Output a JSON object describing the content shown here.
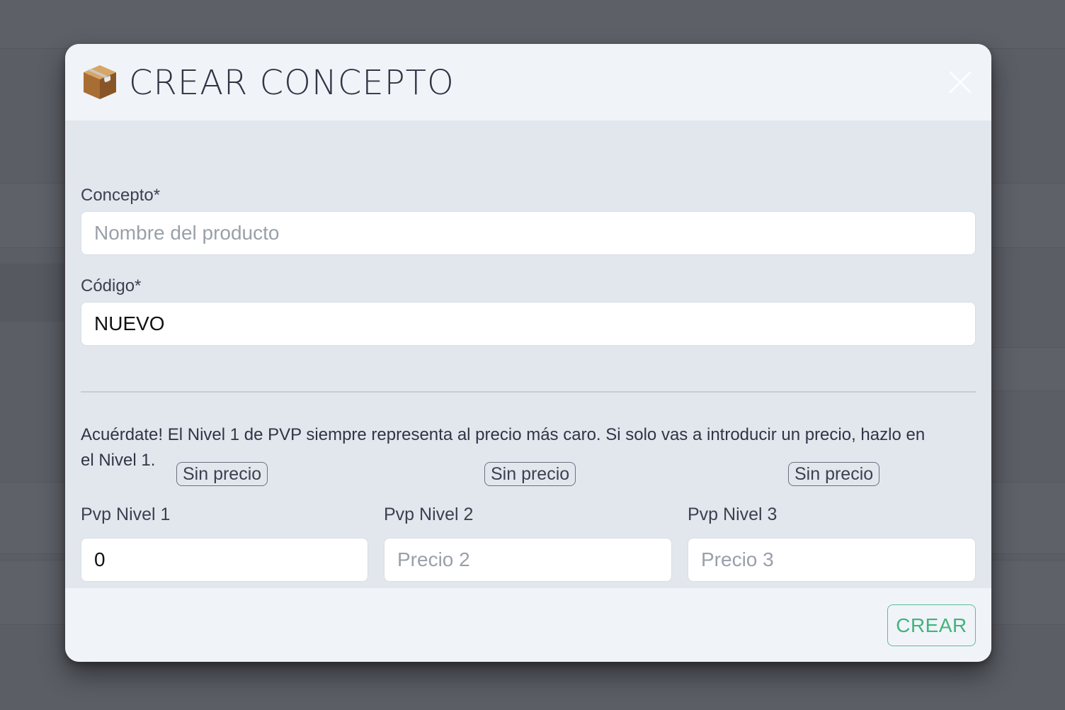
{
  "modal": {
    "title": "CREAR CONCEPTO",
    "title_icon": "package-icon"
  },
  "form": {
    "concepto": {
      "label": "Concepto*",
      "value": "",
      "placeholder": "Nombre del producto"
    },
    "codigo": {
      "label": "Código*",
      "value": "NUEVO",
      "placeholder": ""
    },
    "hint": "Acuérdate! El Nivel 1 de PVP siempre representa al precio más caro. Si solo vas a introducir un precio, hazlo en el Nivel 1.",
    "prices": [
      {
        "label": "Pvp Nivel 1",
        "badge": "Sin precio",
        "value": "0",
        "placeholder": ""
      },
      {
        "label": "Pvp Nivel 2",
        "badge": "Sin precio",
        "value": "",
        "placeholder": "Precio 2"
      },
      {
        "label": "Pvp Nivel 3",
        "badge": "Sin precio",
        "value": "",
        "placeholder": "Precio 3"
      }
    ]
  },
  "footer": {
    "submit_label": "CREAR"
  },
  "colors": {
    "accent_green": "#43b37c",
    "header_bg": "#f0f4f9",
    "body_bg": "#e2e7ee",
    "overlay": "#5b5e65"
  }
}
